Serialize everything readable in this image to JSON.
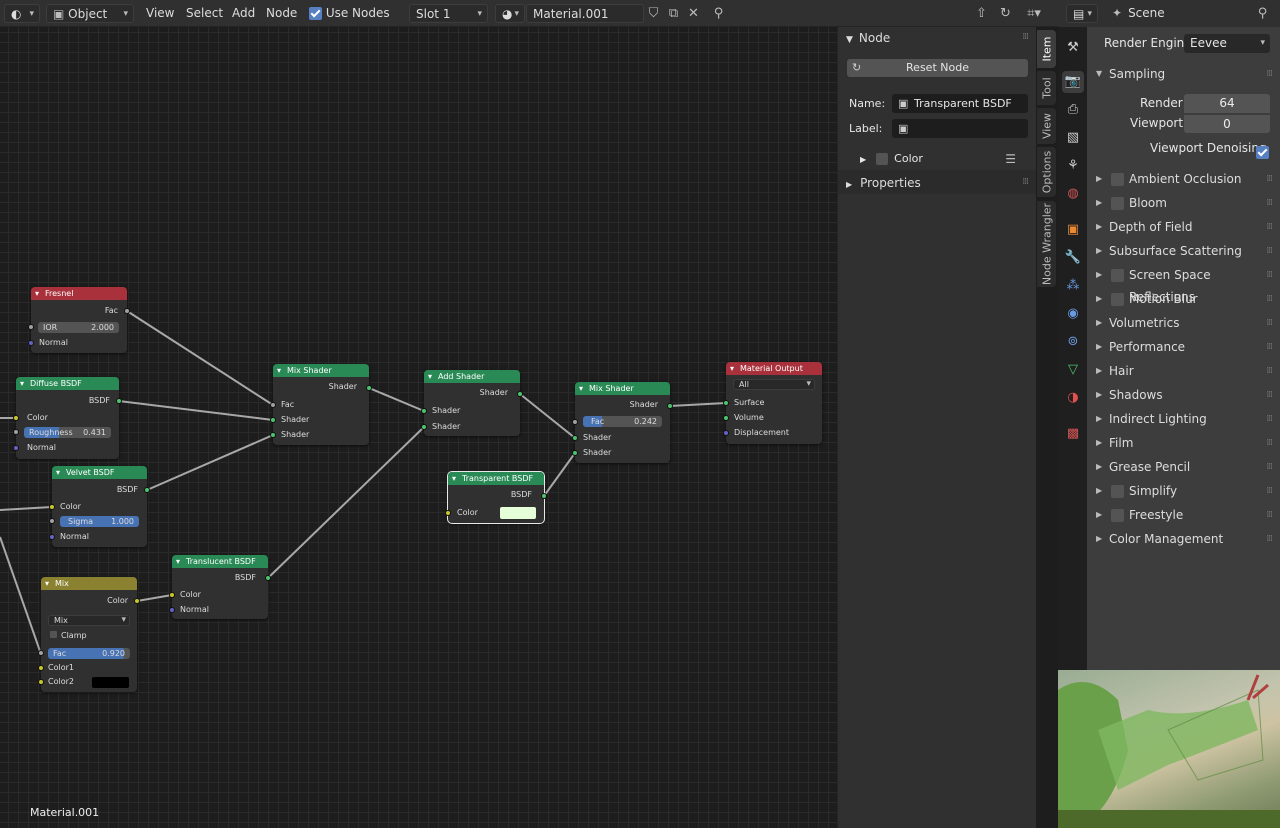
{
  "header": {
    "mode": "Object",
    "menus": [
      "View",
      "Select",
      "Add",
      "Node"
    ],
    "use_nodes_label": "Use Nodes",
    "slot": "Slot 1",
    "material": "Material.001"
  },
  "nodes": {
    "fresnel": {
      "title": "Fresnel",
      "fac": "Fac",
      "ior_label": "IOR",
      "ior_value": "2.000",
      "normal": "Normal"
    },
    "diffuse": {
      "title": "Diffuse BSDF",
      "bsdf": "BSDF",
      "color": "Color",
      "roughness_label": "Roughness",
      "roughness_value": "0.431",
      "normal": "Normal"
    },
    "velvet": {
      "title": "Velvet BSDF",
      "bsdf": "BSDF",
      "color": "Color",
      "sigma_label": "Sigma",
      "sigma_value": "1.000",
      "normal": "Normal"
    },
    "mix": {
      "title": "Mix",
      "color_out": "Color",
      "blend": "Mix",
      "clamp": "Clamp",
      "fac_label": "Fac",
      "fac_value": "0.920",
      "color1": "Color1",
      "color2": "Color2"
    },
    "translucent": {
      "title": "Translucent BSDF",
      "bsdf": "BSDF",
      "color": "Color",
      "normal": "Normal"
    },
    "mix_shader1": {
      "title": "Mix Shader",
      "shader_out": "Shader",
      "fac": "Fac",
      "shader1": "Shader",
      "shader2": "Shader"
    },
    "add_shader": {
      "title": "Add Shader",
      "shader_out": "Shader",
      "shader1": "Shader",
      "shader2": "Shader"
    },
    "transparent": {
      "title": "Transparent BSDF",
      "bsdf": "BSDF",
      "color": "Color"
    },
    "mix_shader2": {
      "title": "Mix Shader",
      "shader_out": "Shader",
      "fac_label": "Fac",
      "fac_value": "0.242",
      "shader1": "Shader",
      "shader2": "Shader"
    },
    "output": {
      "title": "Material Output",
      "target": "All",
      "surface": "Surface",
      "volume": "Volume",
      "displacement": "Displacement"
    }
  },
  "editor_label": "Material.001",
  "npanel": {
    "node_title": "Node",
    "reset_button": "Reset Node",
    "name_label": "Name:",
    "name_value": "Transparent BSDF",
    "label_label": "Label:",
    "color_label": "Color",
    "properties_label": "Properties",
    "tabs": [
      "Item",
      "Tool",
      "View",
      "Options",
      "Node Wrangler"
    ]
  },
  "properties": {
    "scene_label": "Scene",
    "render_engine_label": "Render Engine",
    "render_engine": "Eevee",
    "sampling_title": "Sampling",
    "render_label": "Render",
    "render_value": "64",
    "viewport_label": "Viewport",
    "viewport_value": "0",
    "viewport_denoising": "Viewport Denoising",
    "panels": [
      {
        "label": "Ambient Occlusion",
        "checkbox": true
      },
      {
        "label": "Bloom",
        "checkbox": true
      },
      {
        "label": "Depth of Field",
        "checkbox": false
      },
      {
        "label": "Subsurface Scattering",
        "checkbox": false
      },
      {
        "label": "Screen Space Reflections",
        "checkbox": true
      },
      {
        "label": "Motion Blur",
        "checkbox": true
      },
      {
        "label": "Volumetrics",
        "checkbox": false
      },
      {
        "label": "Performance",
        "checkbox": false
      },
      {
        "label": "Hair",
        "checkbox": false
      },
      {
        "label": "Shadows",
        "checkbox": false
      },
      {
        "label": "Indirect Lighting",
        "checkbox": false
      },
      {
        "label": "Film",
        "checkbox": false
      },
      {
        "label": "Grease Pencil",
        "checkbox": false
      },
      {
        "label": "Simplify",
        "checkbox": true
      },
      {
        "label": "Freestyle",
        "checkbox": true
      },
      {
        "label": "Color Management",
        "checkbox": false
      }
    ]
  },
  "colors": {
    "shader_header": "#2a8a56",
    "input_header": "#a8313b",
    "color_header": "#8a8230",
    "output_header": "#a8313b",
    "accent": "#4772b3"
  }
}
